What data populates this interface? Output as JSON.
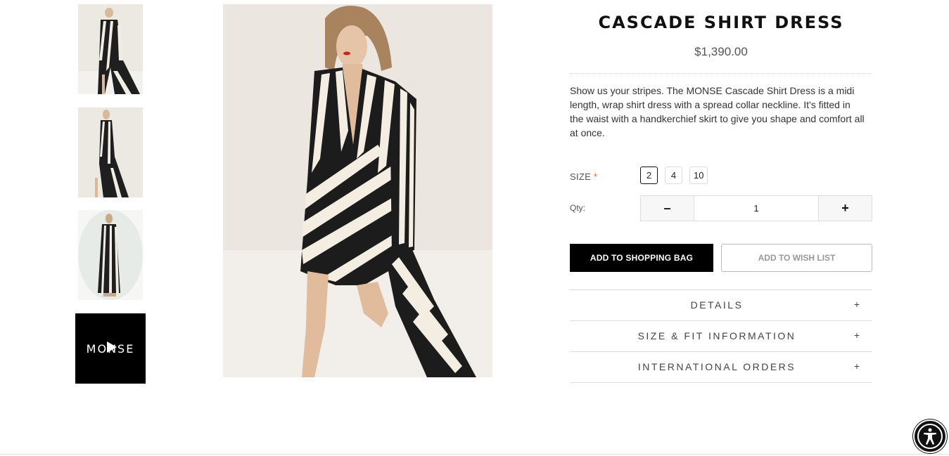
{
  "product": {
    "title": "CASCADE SHIRT DRESS",
    "price": "$1,390.00",
    "description": "Show us your stripes. The MONSE Cascade Shirt Dress is a midi length, wrap shirt dress with a spread collar neckline. It's fitted in the waist with a handkerchief skirt to give you shape and comfort all at once."
  },
  "gallery": {
    "video_thumb_brand": "MONSE"
  },
  "size": {
    "label": "SIZE",
    "required_mark": "*",
    "options": [
      "2",
      "4",
      "10"
    ],
    "selected": "2"
  },
  "qty": {
    "label": "Qty:",
    "value": "1",
    "minus": "–",
    "plus": "+"
  },
  "actions": {
    "add_to_bag": "ADD TO SHOPPING BAG",
    "add_to_wishlist": "ADD TO WISH LIST"
  },
  "accordion": [
    {
      "label": "DETAILS",
      "icon": "+"
    },
    {
      "label": "SIZE & FIT INFORMATION",
      "icon": "+"
    },
    {
      "label": "INTERNATIONAL ORDERS",
      "icon": "+"
    }
  ],
  "colors": {
    "primary": "#000000",
    "required": "#e05a3a"
  }
}
